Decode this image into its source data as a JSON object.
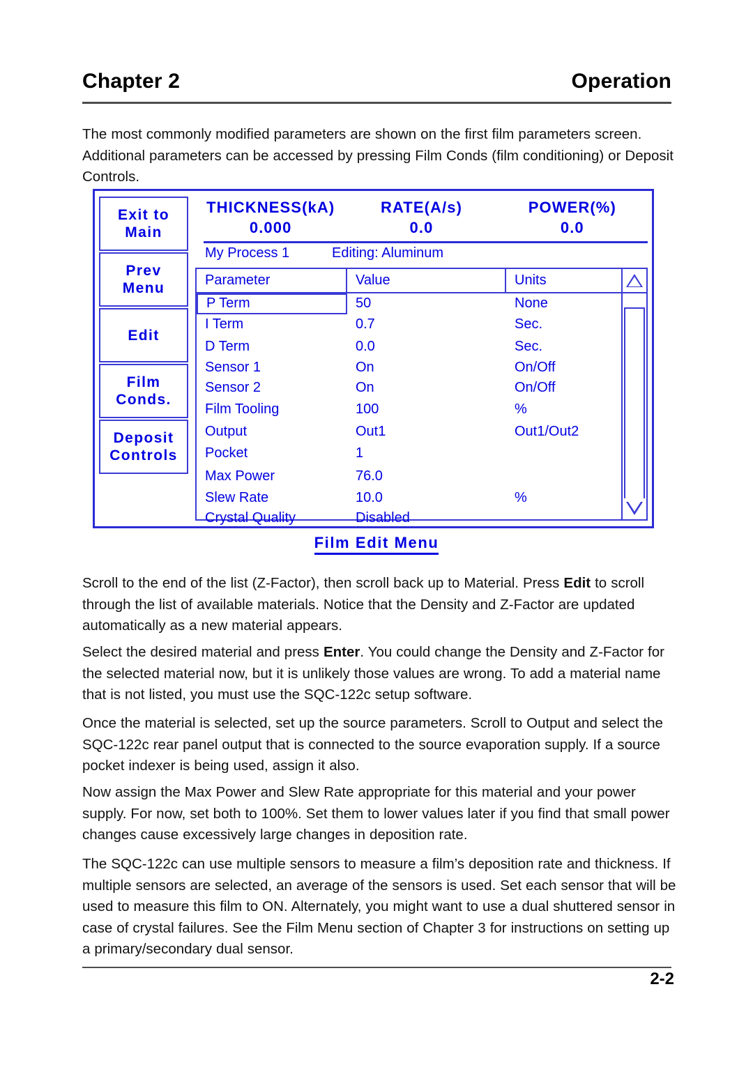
{
  "header": {
    "chapter": "Chapter 2",
    "section": "Operation"
  },
  "paragraphs": {
    "intro": "The most commonly modified parameters are shown on the first film parameters screen. Additional parameters can be accessed by pressing Film Conds (film conditioning) or Deposit Controls.",
    "p2_a": "Scroll to the end of the list (Z-Factor), then scroll back up to Material.  Press ",
    "p2_bold": "Edit",
    "p2_b": " to scroll through the list of available materials.  Notice that the Density and Z-Factor are updated automatically as a new material appears.",
    "p3_a": "Select the desired material and press ",
    "p3_bold": "Enter",
    "p3_b": ".  You could change the Density and Z-Factor for the selected material now, but it is unlikely those values are wrong.  To add a material name that is not listed, you must use the SQC-122c setup software.",
    "p4": "Once the material is selected, set up the source parameters.  Scroll to Output and select the SQC-122c rear panel output that is connected to the source evaporation supply.  If a source pocket indexer is being used, assign it also.",
    "p5": "Now assign the Max Power and Slew Rate appropriate for this material and your power supply.  For now, set both to 100%.  Set them to lower values later if you find that small power changes cause excessively large changes in deposition rate.",
    "p6": "The SQC-122c can use multiple sensors to measure a film’s deposition rate and thickness.  If multiple sensors are selected, an average of the sensors is used.  Set each sensor that will be used to measure this film to ON.  Alternately, you might want to use a dual shuttered sensor in case of crystal failures.  See the Film Menu section of Chapter 3 for instructions on setting up a primary/secondary dual sensor."
  },
  "footer": {
    "page_number": "2-2"
  },
  "figure": {
    "caption": "Film Edit Menu",
    "accent_color": "#0000e0",
    "border_color": "#2b2bd6",
    "softkeys": [
      {
        "line1": "Exit to",
        "line2": "Main"
      },
      {
        "line1": "Prev",
        "line2": "Menu"
      },
      {
        "line1": "Edit",
        "line2": ""
      },
      {
        "line1": "Film",
        "line2": "Conds."
      },
      {
        "line1": "Deposit",
        "line2": "Controls"
      }
    ],
    "status": [
      {
        "label": "THICKNESS(kA)",
        "value": "0.000"
      },
      {
        "label": "RATE(A/s)",
        "value": "0.0"
      },
      {
        "label": "POWER(%)",
        "value": "0.0"
      }
    ],
    "process": {
      "name": "My Process 1",
      "editing": "Editing: Aluminum"
    },
    "table": {
      "columns": [
        "Parameter",
        "Value",
        "Units"
      ],
      "selected_row": 0,
      "rows": [
        {
          "parameter": "P Term",
          "value": "50",
          "units": "None"
        },
        {
          "parameter": "I Term",
          "value": "0.7",
          "units": "Sec."
        },
        {
          "parameter": "D Term",
          "value": "0.0",
          "units": "Sec."
        },
        {
          "parameter": "Sensor 1",
          "value": "On",
          "units": "On/Off"
        },
        {
          "parameter": "Sensor 2",
          "value": "On",
          "units": "On/Off"
        },
        {
          "parameter": "Film Tooling",
          "value": "100",
          "units": "%"
        },
        {
          "parameter": "Output",
          "value": "Out1",
          "units": "Out1/Out2"
        },
        {
          "parameter": "Pocket",
          "value": "1",
          "units": ""
        },
        {
          "parameter": "Max Power",
          "value": "76.0",
          "units": ""
        },
        {
          "parameter": "Slew Rate",
          "value": "10.0",
          "units": "%"
        },
        {
          "parameter": "Crystal Quality",
          "value": "Disabled",
          "units": ""
        }
      ]
    },
    "scrollbar": {
      "up_arrow": "triangle-up-icon",
      "down_arrow": "triangle-down-icon"
    }
  }
}
